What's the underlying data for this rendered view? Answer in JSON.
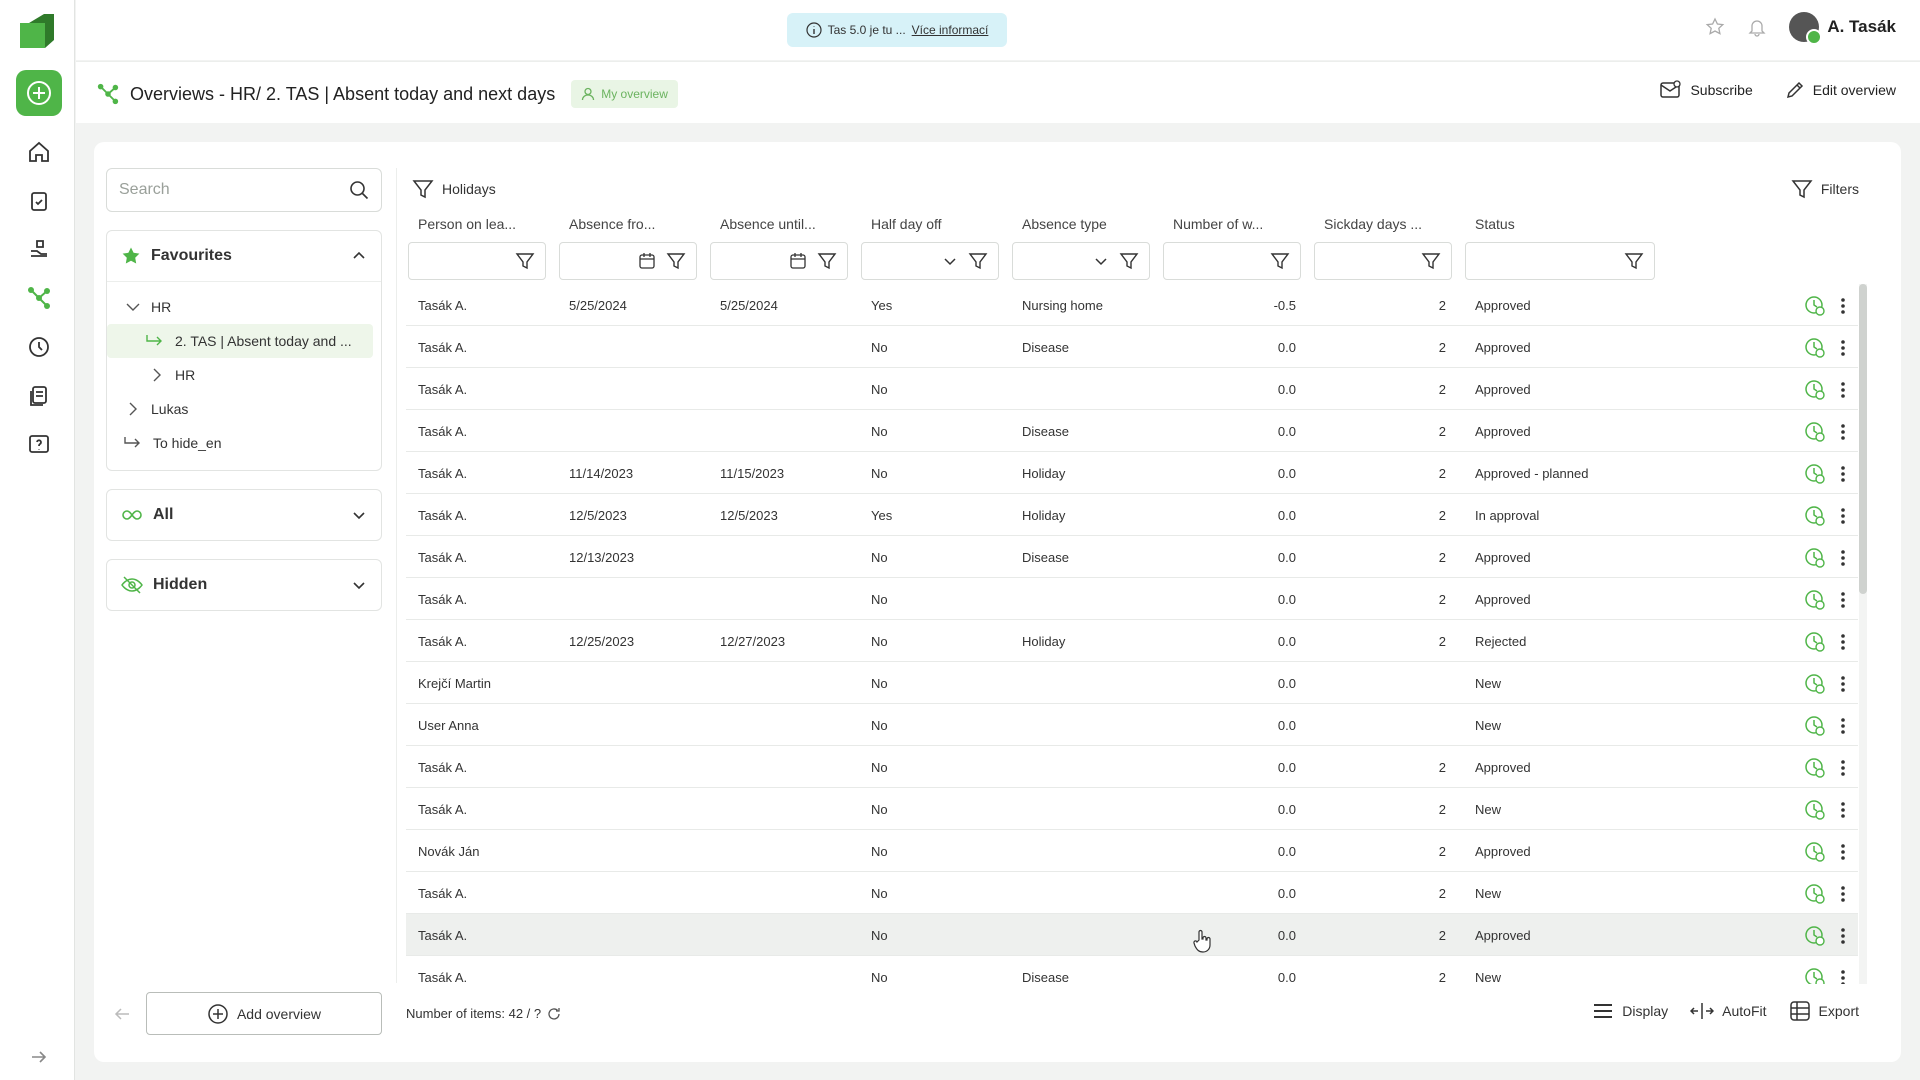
{
  "topbar": {
    "info_text": "Tas 5.0 je tu ...",
    "info_link": "Více informací",
    "user_name": "A. Tasák"
  },
  "header": {
    "title": "Overviews - HR/ 2. TAS | Absent today and next days",
    "my_overview": "My overview",
    "subscribe": "Subscribe",
    "edit_overview": "Edit overview"
  },
  "sidebar": {
    "search_placeholder": "Search",
    "favourites": "Favourites",
    "tree": [
      "HR",
      "2. TAS | Absent today and ...",
      "HR",
      "Lukas",
      "To hide_en"
    ],
    "all": "All",
    "hidden": "Hidden",
    "add_overview": "Add overview"
  },
  "toolbar": {
    "holidays": "Holidays",
    "filters": "Filters"
  },
  "table": {
    "columns": [
      "Person on lea...",
      "Absence fro...",
      "Absence until...",
      "Half day off",
      "Absence type",
      "Number of w...",
      "Sickday days ...",
      "Status"
    ],
    "rows": [
      [
        "Tasák A.",
        "5/25/2024",
        "5/25/2024",
        "Yes",
        "Nursing home",
        "-0.5",
        "2",
        "Approved"
      ],
      [
        "Tasák A.",
        "",
        "",
        "No",
        "Disease",
        "0.0",
        "2",
        "Approved"
      ],
      [
        "Tasák A.",
        "",
        "",
        "No",
        "",
        "0.0",
        "2",
        "Approved"
      ],
      [
        "Tasák A.",
        "",
        "",
        "No",
        "Disease",
        "0.0",
        "2",
        "Approved"
      ],
      [
        "Tasák A.",
        "11/14/2023",
        "11/15/2023",
        "No",
        "Holiday",
        "0.0",
        "2",
        "Approved - planned"
      ],
      [
        "Tasák A.",
        "12/5/2023",
        "12/5/2023",
        "Yes",
        "Holiday",
        "0.0",
        "2",
        "In approval"
      ],
      [
        "Tasák A.",
        "12/13/2023",
        "",
        "No",
        "Disease",
        "0.0",
        "2",
        "Approved"
      ],
      [
        "Tasák A.",
        "",
        "",
        "No",
        "",
        "0.0",
        "2",
        "Approved"
      ],
      [
        "Tasák A.",
        "12/25/2023",
        "12/27/2023",
        "No",
        "Holiday",
        "0.0",
        "2",
        "Rejected"
      ],
      [
        "Krejčí Martin",
        "",
        "",
        "No",
        "",
        "0.0",
        "",
        "New"
      ],
      [
        "User Anna",
        "",
        "",
        "No",
        "",
        "0.0",
        "",
        "New"
      ],
      [
        "Tasák A.",
        "",
        "",
        "No",
        "",
        "0.0",
        "2",
        "Approved"
      ],
      [
        "Tasák A.",
        "",
        "",
        "No",
        "",
        "0.0",
        "2",
        "New"
      ],
      [
        "Novák Ján",
        "",
        "",
        "No",
        "",
        "0.0",
        "2",
        "Approved"
      ],
      [
        "Tasák A.",
        "",
        "",
        "No",
        "",
        "0.0",
        "2",
        "New"
      ],
      [
        "Tasák A.",
        "",
        "",
        "No",
        "",
        "0.0",
        "2",
        "Approved"
      ],
      [
        "Tasák A.",
        "",
        "",
        "No",
        "Disease",
        "0.0",
        "2",
        "New"
      ]
    ]
  },
  "footer": {
    "count": "Number of items: 42 / ?",
    "display": "Display",
    "autofit": "AutoFit",
    "export": "Export"
  },
  "colors": {
    "accent": "#4fb548",
    "selected_bg": "#eef6ea",
    "info_bg": "#d7f2f8"
  }
}
